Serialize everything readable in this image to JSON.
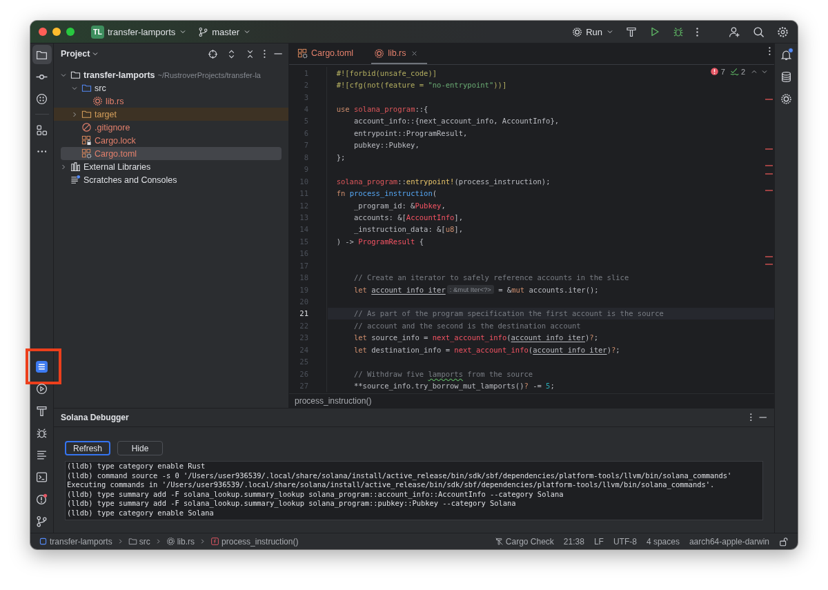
{
  "window": {
    "project_badge": "TL",
    "project_name": "transfer-lamports",
    "branch": "master",
    "run_label": "Run"
  },
  "tool_windows": {
    "top": [
      {
        "kind": "project",
        "selected": true
      },
      {
        "kind": "commit",
        "selected": false
      },
      {
        "kind": "plugins",
        "selected": false
      },
      {
        "kind": "structure",
        "selected": false
      },
      {
        "kind": "more",
        "selected": false
      }
    ],
    "bottom": [
      {
        "kind": "solana",
        "highlighted": true
      },
      {
        "kind": "run"
      },
      {
        "kind": "build"
      },
      {
        "kind": "debug"
      },
      {
        "kind": "list"
      },
      {
        "kind": "terminal"
      },
      {
        "kind": "problems"
      },
      {
        "kind": "git"
      }
    ],
    "right": [
      {
        "kind": "notifications",
        "unread": true
      },
      {
        "kind": "database",
        "unread": false
      },
      {
        "kind": "rust",
        "unread": false
      }
    ]
  },
  "project": {
    "title": "Project",
    "tree": [
      {
        "label": "transfer-lamports",
        "kind": "folder",
        "path": "~/RustroverProjects/transfer-la",
        "expanded": true,
        "selected": false,
        "unversioned": false,
        "excluded": false,
        "children": [
          {
            "label": "src",
            "kind": "source-folder",
            "expanded": true,
            "selected": false,
            "unversioned": false,
            "excluded": false,
            "children": [
              {
                "label": "lib.rs",
                "kind": "rust",
                "selected": false,
                "unversioned": true,
                "excluded": false
              }
            ]
          },
          {
            "label": "target",
            "kind": "excluded-folder",
            "expanded": false,
            "selected": false,
            "unversioned": false,
            "excluded": true
          },
          {
            "label": ".gitignore",
            "kind": "ignore",
            "selected": false,
            "unversioned": true,
            "excluded": false
          },
          {
            "label": "Cargo.lock",
            "kind": "cargo-lock",
            "selected": false,
            "unversioned": true,
            "excluded": false
          },
          {
            "label": "Cargo.toml",
            "kind": "cargo",
            "selected": true,
            "unversioned": true,
            "excluded": false
          }
        ]
      },
      {
        "label": "External Libraries",
        "kind": "libraries",
        "expanded": false,
        "selected": false,
        "unversioned": false,
        "excluded": false
      },
      {
        "label": "Scratches and Consoles",
        "kind": "scratches",
        "selected": false,
        "unversioned": false,
        "excluded": false
      }
    ]
  },
  "editor": {
    "tabs": [
      {
        "label": "Cargo.toml",
        "kind": "cargo",
        "selected": false
      },
      {
        "label": "lib.rs",
        "kind": "rust",
        "selected": true
      }
    ],
    "inspections": {
      "errors": "7",
      "warnings": "2"
    },
    "lines": [
      {
        "number": "1",
        "current": false,
        "tokens": [
          {
            "kind": "attr",
            "text": "#![forbid(unsafe_code)]"
          }
        ]
      },
      {
        "number": "2",
        "current": false,
        "tokens": [
          {
            "kind": "attr",
            "text": "#![cfg(not(feature = "
          },
          {
            "kind": "str",
            "text": "\"no-entrypoint\""
          },
          {
            "kind": "attr",
            "text": "))]"
          }
        ]
      },
      {
        "number": "3",
        "current": false
      },
      {
        "number": "4",
        "current": false,
        "tokens": [
          {
            "kind": "kw",
            "text": "use "
          },
          {
            "kind": "crate",
            "text": "solana_program"
          },
          {
            "kind": "plain",
            "text": "::{"
          }
        ]
      },
      {
        "number": "5",
        "current": false,
        "tokens": [
          {
            "kind": "plain",
            "text": "    account_info::{next_account_info, AccountInfo},"
          }
        ]
      },
      {
        "number": "6",
        "current": false,
        "tokens": [
          {
            "kind": "plain",
            "text": "    entrypoint::ProgramResult,"
          }
        ]
      },
      {
        "number": "7",
        "current": false,
        "tokens": [
          {
            "kind": "plain",
            "text": "    pubkey::Pubkey,"
          }
        ]
      },
      {
        "number": "8",
        "current": false,
        "tokens": [
          {
            "kind": "plain",
            "text": "};"
          }
        ]
      },
      {
        "number": "9",
        "current": false
      },
      {
        "number": "10",
        "current": false,
        "tokens": [
          {
            "kind": "crate",
            "text": "solana_program"
          },
          {
            "kind": "plain",
            "text": "::"
          },
          {
            "kind": "macro",
            "text": "entrypoint!"
          },
          {
            "kind": "plain",
            "text": "(process_instruction);"
          }
        ]
      },
      {
        "number": "11",
        "current": false,
        "tokens": [
          {
            "kind": "kw",
            "text": "fn "
          },
          {
            "kind": "fn",
            "text": "process_instruction"
          },
          {
            "kind": "plain",
            "text": "("
          }
        ]
      },
      {
        "number": "12",
        "current": false,
        "tokens": [
          {
            "kind": "plain",
            "text": "    _program_id: &"
          },
          {
            "kind": "type",
            "text": "Pubkey"
          },
          {
            "kind": "plain",
            "text": ","
          }
        ]
      },
      {
        "number": "13",
        "current": false,
        "tokens": [
          {
            "kind": "plain",
            "text": "    accounts: &["
          },
          {
            "kind": "type",
            "text": "AccountInfo"
          },
          {
            "kind": "plain",
            "text": "],"
          }
        ]
      },
      {
        "number": "14",
        "current": false,
        "tokens": [
          {
            "kind": "plain",
            "text": "    _instruction_data: &["
          },
          {
            "kind": "kw",
            "text": "u8"
          },
          {
            "kind": "plain",
            "text": "],"
          }
        ]
      },
      {
        "number": "15",
        "current": false,
        "tokens": [
          {
            "kind": "plain",
            "text": ") -> "
          },
          {
            "kind": "type",
            "text": "ProgramResult"
          },
          {
            "kind": "plain",
            "text": " {"
          }
        ]
      },
      {
        "number": "16",
        "current": false
      },
      {
        "number": "17",
        "current": false
      },
      {
        "number": "18",
        "current": false,
        "tokens": [
          {
            "kind": "comment",
            "text": "    // Create an iterator to safely reference accounts in the slice"
          }
        ]
      },
      {
        "number": "19",
        "current": false,
        "tokens": [
          {
            "kind": "kw",
            "text": "    let "
          },
          {
            "kind": "var",
            "text": "account_info_iter"
          },
          {
            "kind": "hint",
            "text": ": &mut Iter<?>"
          },
          {
            "kind": "plain",
            "text": " = &"
          },
          {
            "kind": "kw",
            "text": "mut"
          },
          {
            "kind": "plain",
            "text": " accounts.iter();"
          }
        ]
      },
      {
        "number": "20",
        "current": false
      },
      {
        "number": "21",
        "current": true,
        "tokens": [
          {
            "kind": "comment",
            "text": "    // As part of the program specification the first account is the source"
          }
        ]
      },
      {
        "number": "22",
        "current": false,
        "tokens": [
          {
            "kind": "comment",
            "text": "    // account and the second is the destination account"
          }
        ]
      },
      {
        "number": "23",
        "current": false,
        "tokens": [
          {
            "kind": "kw",
            "text": "    let"
          },
          {
            "kind": "plain",
            "text": " source_info = "
          },
          {
            "kind": "type",
            "text": "next_account_info"
          },
          {
            "kind": "plain",
            "text": "("
          },
          {
            "kind": "var",
            "text": "account_info_iter"
          },
          {
            "kind": "plain",
            "text": ")"
          },
          {
            "kind": "kw",
            "text": "?"
          },
          {
            "kind": "plain",
            "text": ";"
          }
        ]
      },
      {
        "number": "24",
        "current": false,
        "tokens": [
          {
            "kind": "kw",
            "text": "    let"
          },
          {
            "kind": "plain",
            "text": " destination_info = "
          },
          {
            "kind": "type",
            "text": "next_account_info"
          },
          {
            "kind": "plain",
            "text": "("
          },
          {
            "kind": "var",
            "text": "account_info_iter"
          },
          {
            "kind": "plain",
            "text": ")"
          },
          {
            "kind": "kw",
            "text": "?"
          },
          {
            "kind": "plain",
            "text": ";"
          }
        ]
      },
      {
        "number": "25",
        "current": false
      },
      {
        "number": "26",
        "current": false,
        "tokens": [
          {
            "kind": "comment",
            "text": "    // Withdraw five "
          },
          {
            "kind": "typo",
            "text": "lamports"
          },
          {
            "kind": "comment",
            "text": " from the source"
          }
        ]
      },
      {
        "number": "27",
        "current": false,
        "tokens": [
          {
            "kind": "plain",
            "text": "    **source_info.try_borrow_mut_lamports()"
          },
          {
            "kind": "kw",
            "text": "?"
          },
          {
            "kind": "plain",
            "text": " -= "
          },
          {
            "kind": "num",
            "text": "5"
          },
          {
            "kind": "plain",
            "text": ";"
          }
        ]
      }
    ],
    "breadcrumb": "process_instruction()"
  },
  "debugger": {
    "title": "Solana Debugger",
    "buttons": [
      {
        "label": "Refresh",
        "focused": true
      },
      {
        "label": "Hide",
        "focused": false
      }
    ],
    "log": [
      "(lldb) type category enable Rust",
      "(lldb) command source -s 0 '/Users/user936539/.local/share/solana/install/active_release/bin/sdk/sbf/dependencies/platform-tools/llvm/bin/solana_commands'",
      "Executing commands in '/Users/user936539/.local/share/solana/install/active_release/bin/sdk/sbf/dependencies/platform-tools/llvm/bin/solana_commands'.",
      "(lldb) type summary add -F solana_lookup.summary_lookup solana_program::account_info::AccountInfo --category Solana",
      "(lldb) type summary add -F solana_lookup.summary_lookup solana_program::pubkey::Pubkey --category Solana",
      "(lldb) type category enable Solana"
    ]
  },
  "status_bar": {
    "breadcrumbs": [
      {
        "kind": "module",
        "label": "transfer-lamports"
      },
      {
        "kind": "folder",
        "label": "src"
      },
      {
        "kind": "rust",
        "label": "lib.rs"
      },
      {
        "kind": "function",
        "label": "process_instruction()"
      }
    ],
    "widgets": [
      {
        "kind": "cargo",
        "label": "Cargo Check"
      },
      {
        "kind": "text",
        "label": "21:38"
      },
      {
        "kind": "text",
        "label": "LF"
      },
      {
        "kind": "text",
        "label": "UTF-8"
      },
      {
        "kind": "text",
        "label": "4 spaces"
      },
      {
        "kind": "text",
        "label": "aarch64-apple-darwin"
      }
    ]
  }
}
